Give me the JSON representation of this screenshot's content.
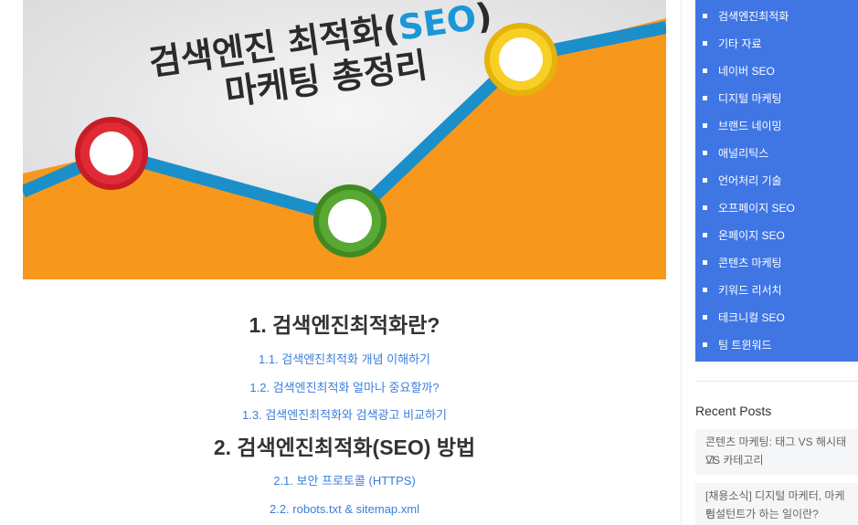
{
  "hero": {
    "title_line1_prefix": "검색엔진 최적화(",
    "title_line1_seo": "SEO",
    "title_line1_suffix": ")",
    "title_line2": "마케팅 총정리",
    "colors": {
      "orange": "#f7981d",
      "blue_line": "#1b8fc9",
      "red_node": "#d6202d",
      "green_node": "#4e9a2b",
      "yellow_node": "#f4c417"
    }
  },
  "toc": {
    "heading1": "1. 검색엔진최적화란?",
    "items1": [
      "1.1. 검색엔진최적화 개념 이해하기",
      "1.2. 검색엔진최적화 얼마나 중요할까?",
      "1.3. 검색엔진최적화와 검색광고 비교하기"
    ],
    "heading2": "2. 검색엔진최적화(SEO) 방법",
    "items2": [
      "2.1. 보안 프로토콜 (HTTPS)",
      "2.2. robots.txt & sitemap.xml"
    ]
  },
  "sidebar": {
    "categories": [
      "검색엔진최적화",
      "기타 자료",
      "네이버 SEO",
      "디지털 마케팅",
      "브랜드 네이밍",
      "애널리틱스",
      "언어처리 기술",
      "오프페이지 SEO",
      "온페이지 SEO",
      "콘텐츠 마케팅",
      "키워드 리서치",
      "테크니컬 SEO",
      "팀 트윈워드"
    ],
    "recent_title": "Recent Posts",
    "recent_posts": [
      [
        "콘텐츠 마케팅: 태그 VS 해시태그",
        "VS 카테고리"
      ],
      [
        "[채용소식] 디지털 마케터, 마케팅",
        "컨설턴트가 하는 일이란?"
      ]
    ],
    "accent": "#3f76e4"
  }
}
